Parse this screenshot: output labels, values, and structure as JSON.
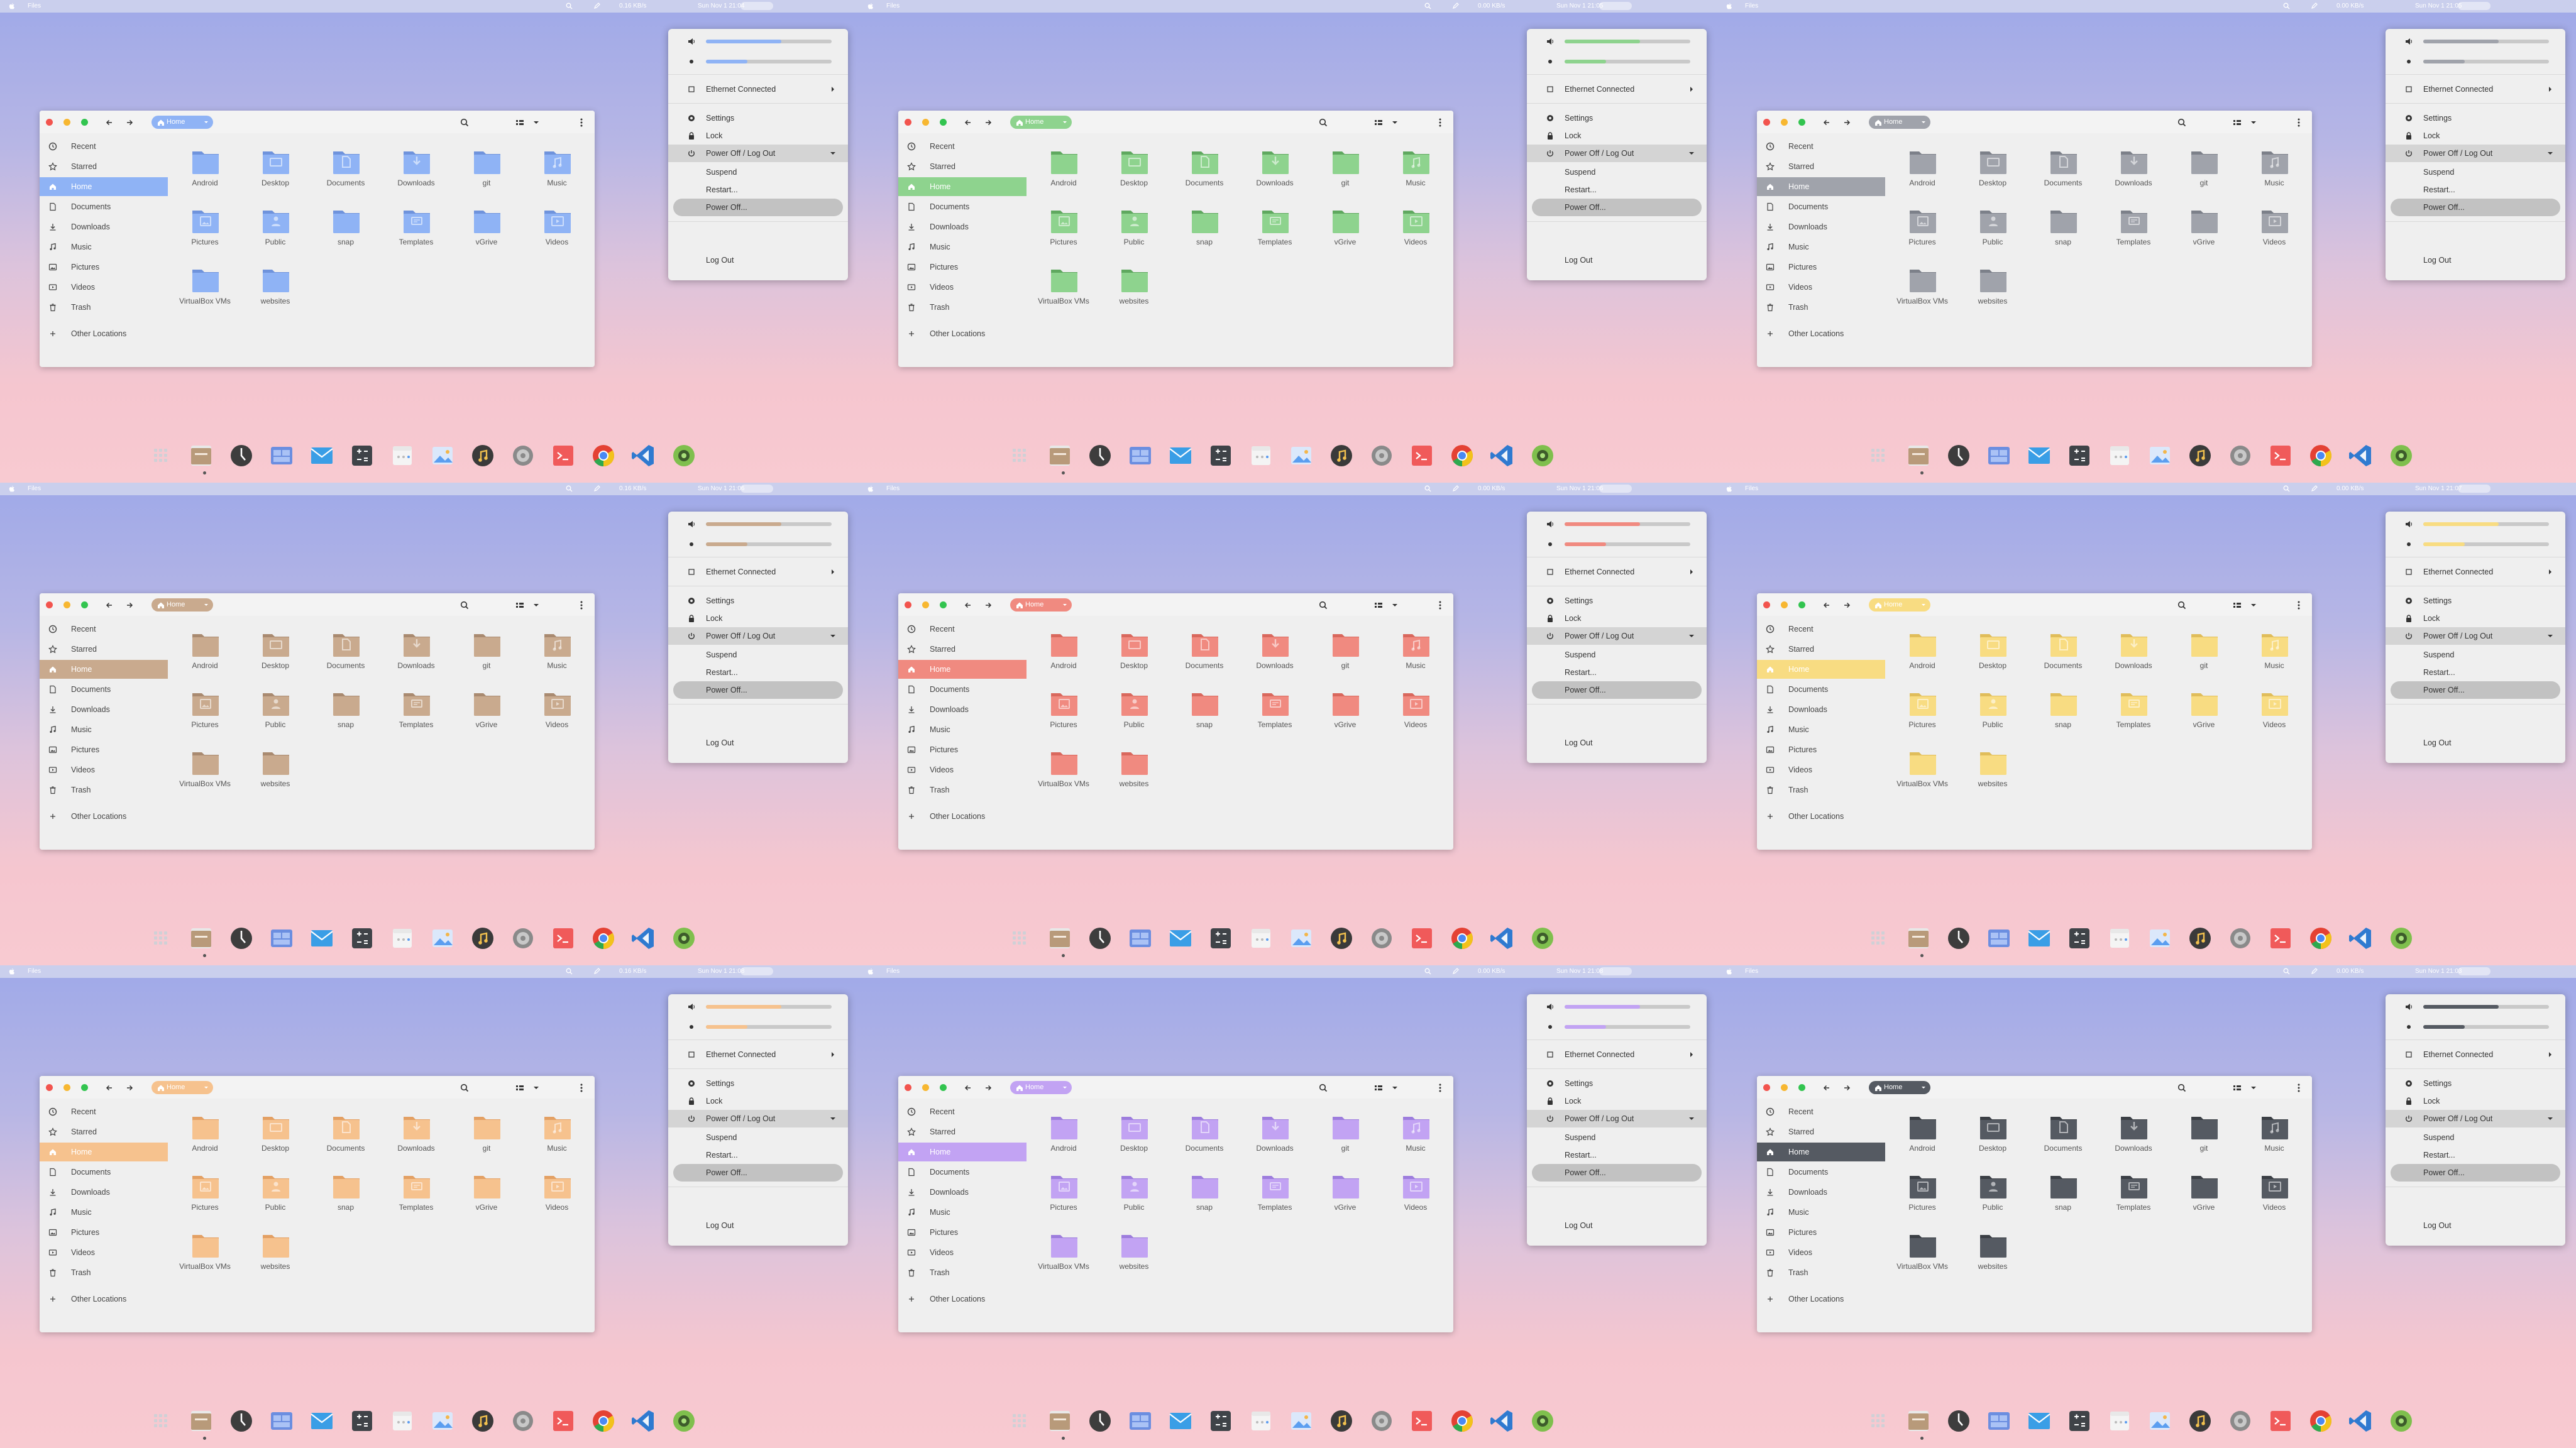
{
  "screens": [
    {
      "accent": "#8fb3f5",
      "accent_dark": "#6f93dc",
      "label_fg": "#ffffff",
      "net": "0.16 KB/s",
      "clock": "Sun Nov 1  21:04"
    },
    {
      "accent": "#8ed38e",
      "accent_dark": "#5fa85f",
      "label_fg": "#ffffff",
      "net": "0.00 KB/s",
      "clock": "Sun Nov 1  21:05"
    },
    {
      "accent": "#a0a3ab",
      "accent_dark": "#7c8089",
      "label_fg": "#ffffff",
      "net": "0.00 KB/s",
      "clock": "Sun Nov 1  21:05"
    },
    {
      "accent": "#c9aa8e",
      "accent_dark": "#a98a70",
      "label_fg": "#ffffff",
      "net": "0.16 KB/s",
      "clock": "Sun Nov 1  21:06"
    },
    {
      "accent": "#f08a80",
      "accent_dark": "#d9685d",
      "label_fg": "#ffffff",
      "net": "0.00 KB/s",
      "clock": "Sun Nov 1  21:06"
    },
    {
      "accent": "#f8dc82",
      "accent_dark": "#e0bd5a",
      "label_fg": "#ffffff",
      "net": "0.00 KB/s",
      "clock": "Sun Nov 1  21:07"
    },
    {
      "accent": "#f6c28e",
      "accent_dark": "#e3a064",
      "label_fg": "#ffffff",
      "net": "0.16 KB/s",
      "clock": "Sun Nov 1  21:08"
    },
    {
      "accent": "#c2a3f3",
      "accent_dark": "#9d7ddd",
      "label_fg": "#ffffff",
      "net": "0.00 KB/s",
      "clock": "Sun Nov 1  21:08"
    },
    {
      "accent": "#555a62",
      "accent_dark": "#3b3f45",
      "label_fg": "#ffffff",
      "net": "0.00 KB/s",
      "clock": "Sun Nov 1  21:03"
    }
  ],
  "topbar": {
    "app_name": "Files"
  },
  "window": {
    "breadcrumb": "Home"
  },
  "sidebar": {
    "items": [
      {
        "label": "Recent",
        "icon": "clock-icon"
      },
      {
        "label": "Starred",
        "icon": "star-icon"
      },
      {
        "label": "Home",
        "icon": "home-icon"
      },
      {
        "label": "Documents",
        "icon": "document-icon"
      },
      {
        "label": "Downloads",
        "icon": "download-icon"
      },
      {
        "label": "Music",
        "icon": "music-icon"
      },
      {
        "label": "Pictures",
        "icon": "picture-icon"
      },
      {
        "label": "Videos",
        "icon": "video-icon"
      },
      {
        "label": "Trash",
        "icon": "trash-icon"
      }
    ],
    "other": "Other Locations",
    "active_index": 2
  },
  "folders": [
    {
      "name": "Android",
      "glyph": ""
    },
    {
      "name": "Desktop",
      "glyph": "desktop"
    },
    {
      "name": "Documents",
      "glyph": "doc"
    },
    {
      "name": "Downloads",
      "glyph": "down"
    },
    {
      "name": "git",
      "glyph": ""
    },
    {
      "name": "Music",
      "glyph": "music"
    },
    {
      "name": "Pictures",
      "glyph": "pic"
    },
    {
      "name": "Public",
      "glyph": "person"
    },
    {
      "name": "snap",
      "glyph": ""
    },
    {
      "name": "Templates",
      "glyph": "tmpl"
    },
    {
      "name": "vGrive",
      "glyph": ""
    },
    {
      "name": "Videos",
      "glyph": "video"
    },
    {
      "name": "VirtualBox VMs",
      "glyph": ""
    },
    {
      "name": "websites",
      "glyph": ""
    }
  ],
  "menu": {
    "volume_level": 0.6,
    "mic_level": 0.33,
    "ethernet": "Ethernet Connected",
    "settings": "Settings",
    "lock": "Lock",
    "power_header": "Power Off / Log Out",
    "suspend": "Suspend",
    "restart": "Restart...",
    "poweroff": "Power Off...",
    "logout": "Log Out"
  },
  "dock": {
    "apps": [
      {
        "name": "app-grid-icon",
        "color": "#d0d0d6"
      },
      {
        "name": "file-manager-icon",
        "color": "#b89a7a"
      },
      {
        "name": "clock-app-icon",
        "color": "#3d3d3d"
      },
      {
        "name": "workspace-icon",
        "color": "#6b8ee0"
      },
      {
        "name": "mail-icon",
        "color": "#3a9ee6"
      },
      {
        "name": "calculator-icon",
        "color": "#3f4348"
      },
      {
        "name": "calendar-icon",
        "color": "#f4f4f4"
      },
      {
        "name": "image-viewer-icon",
        "color": "#5b9ef0"
      },
      {
        "name": "music-player-icon",
        "color": "#3a3a3a"
      },
      {
        "name": "settings-app-icon",
        "color": "#8a8a8a"
      },
      {
        "name": "terminal-icon",
        "color": "#f05a5a"
      },
      {
        "name": "chrome-icon",
        "color": "#f2c21b"
      },
      {
        "name": "vscode-icon",
        "color": "#2f7ad0"
      },
      {
        "name": "android-studio-icon",
        "color": "#7fbf4d"
      }
    ]
  }
}
